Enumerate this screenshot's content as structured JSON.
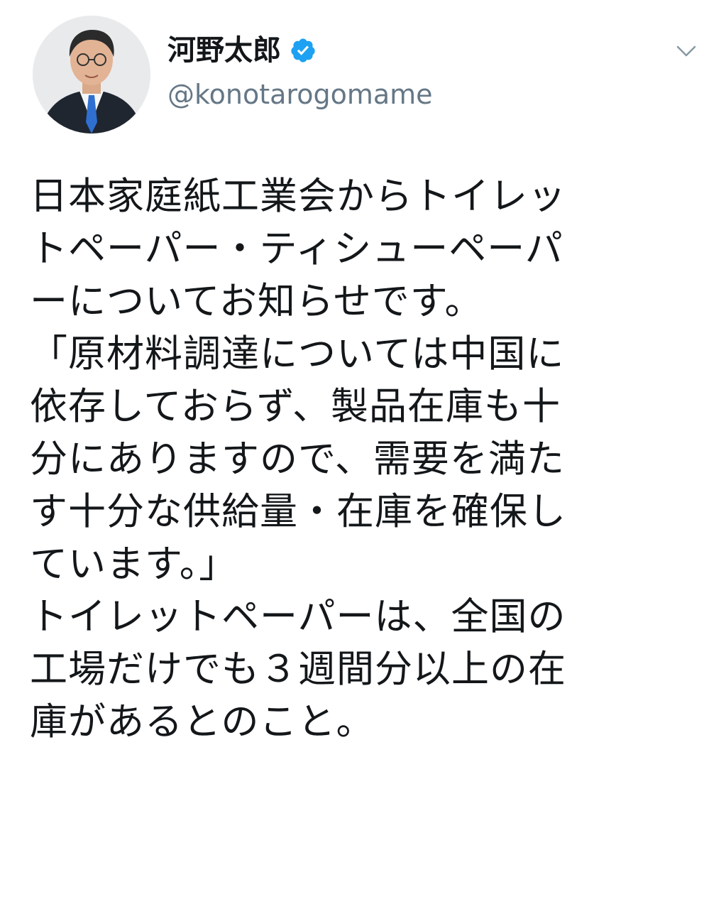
{
  "colors": {
    "text": "#14171a",
    "secondary_text": "#657786",
    "verified_blue": "#1da1f2",
    "background": "#ffffff"
  },
  "author": {
    "display_name": "河野太郎",
    "handle": "@konotarogomame",
    "verified": true,
    "verified_icon": "verified-badge-icon",
    "avatar_icon": "profile-photo"
  },
  "menu": {
    "icon": "chevron-down-icon"
  },
  "tweet": {
    "lines": [
      "日本家庭紙工業会からトイレッ",
      "トペーパー・ティシューペーパ",
      "ーについてお知らせです。",
      "「原材料調達については中国に",
      "依存しておらず、製品在庫も十",
      "分にありますので、需要を満た",
      "す十分な供給量・在庫を確保し",
      "ています。」",
      "トイレットペーパーは、全国の",
      "工場だけでも３週間分以上の在",
      "庫があるとのこと。"
    ]
  }
}
